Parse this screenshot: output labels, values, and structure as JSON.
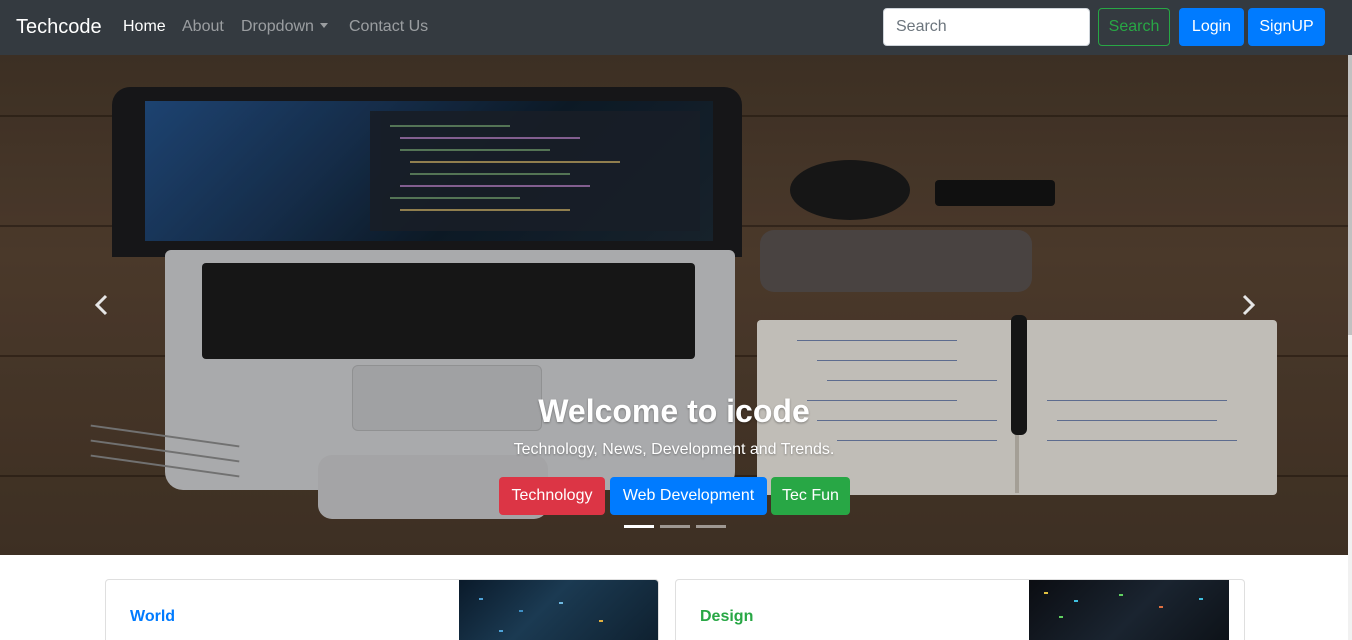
{
  "navbar": {
    "brand": "Techcode",
    "links": [
      {
        "label": "Home",
        "active": true
      },
      {
        "label": "About",
        "active": false
      },
      {
        "label": "Dropdown",
        "active": false
      },
      {
        "label": "Contact Us",
        "active": false
      }
    ],
    "search_placeholder": "Search",
    "search_button": "Search",
    "login_button": "Login",
    "signup_button": "SignUP"
  },
  "carousel": {
    "title": "Welcome to icode",
    "subtitle": "Technology, News, Development and Trends.",
    "buttons": [
      {
        "label": "Technology",
        "color": "#dc3545"
      },
      {
        "label": "Web Development",
        "color": "#007bff"
      },
      {
        "label": "Tec Fun",
        "color": "#28a745"
      }
    ],
    "slide_count": 3,
    "active_slide": 1,
    "prev_icon": "chevron-left-icon",
    "next_icon": "chevron-right-icon"
  },
  "cards": [
    {
      "category": "World",
      "category_color": "#007bff"
    },
    {
      "category": "Design",
      "category_color": "#28a745"
    }
  ],
  "colors": {
    "navbar_bg": "#343a40",
    "primary": "#007bff",
    "success": "#28a745",
    "danger": "#dc3545"
  }
}
